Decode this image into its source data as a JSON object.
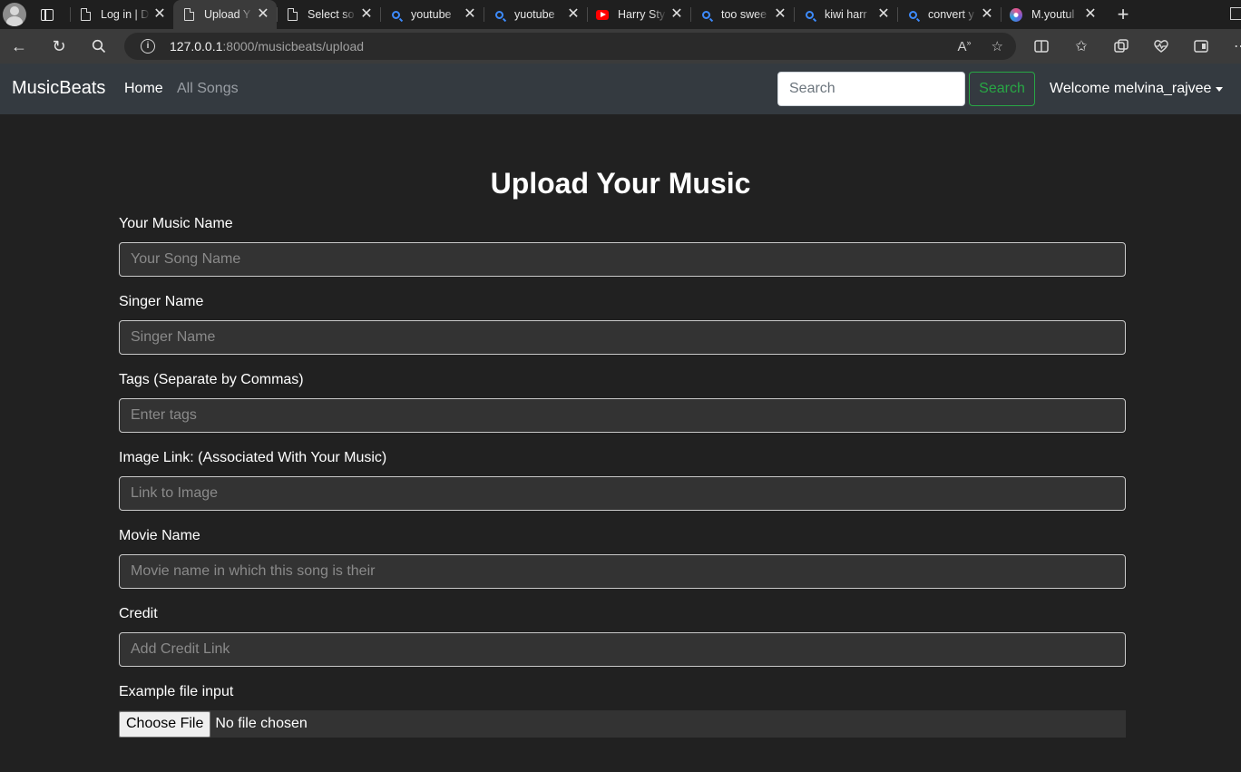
{
  "browser": {
    "tabs": [
      {
        "title": "Log in | D",
        "favicon": "page-icon"
      },
      {
        "title": "Upload Y",
        "favicon": "page-icon",
        "active": true
      },
      {
        "title": "Select so",
        "favicon": "page-icon"
      },
      {
        "title": "youtube",
        "favicon": "search-icon"
      },
      {
        "title": "yuotube",
        "favicon": "search-icon"
      },
      {
        "title": "Harry Sty",
        "favicon": "youtube-icon"
      },
      {
        "title": "too swee",
        "favicon": "search-icon"
      },
      {
        "title": "kiwi harr",
        "favicon": "search-icon"
      },
      {
        "title": "convert y",
        "favicon": "search-icon"
      },
      {
        "title": "M.youtul",
        "favicon": "flower-icon"
      }
    ],
    "url_host": "127.0.0.1",
    "url_path": ":8000/musicbeats/upload"
  },
  "navbar": {
    "brand": "MusicBeats",
    "home": "Home",
    "all_songs": "All Songs",
    "search_placeholder": "Search",
    "search_button": "Search",
    "welcome": "Welcome melvina_rajvee"
  },
  "form": {
    "title": "Upload Your Music",
    "fields": [
      {
        "label": "Your Music Name",
        "placeholder": "Your Song Name"
      },
      {
        "label": "Singer Name",
        "placeholder": "Singer Name"
      },
      {
        "label": "Tags (Separate by Commas)",
        "placeholder": "Enter tags"
      },
      {
        "label": "Image Link: (Associated With Your Music)",
        "placeholder": "Link to Image"
      },
      {
        "label": "Movie Name",
        "placeholder": "Movie name in which this song is their"
      },
      {
        "label": "Credit",
        "placeholder": "Add Credit Link"
      }
    ],
    "file_label": "Example file input",
    "file_button": "Choose File",
    "file_status": "No file chosen"
  }
}
